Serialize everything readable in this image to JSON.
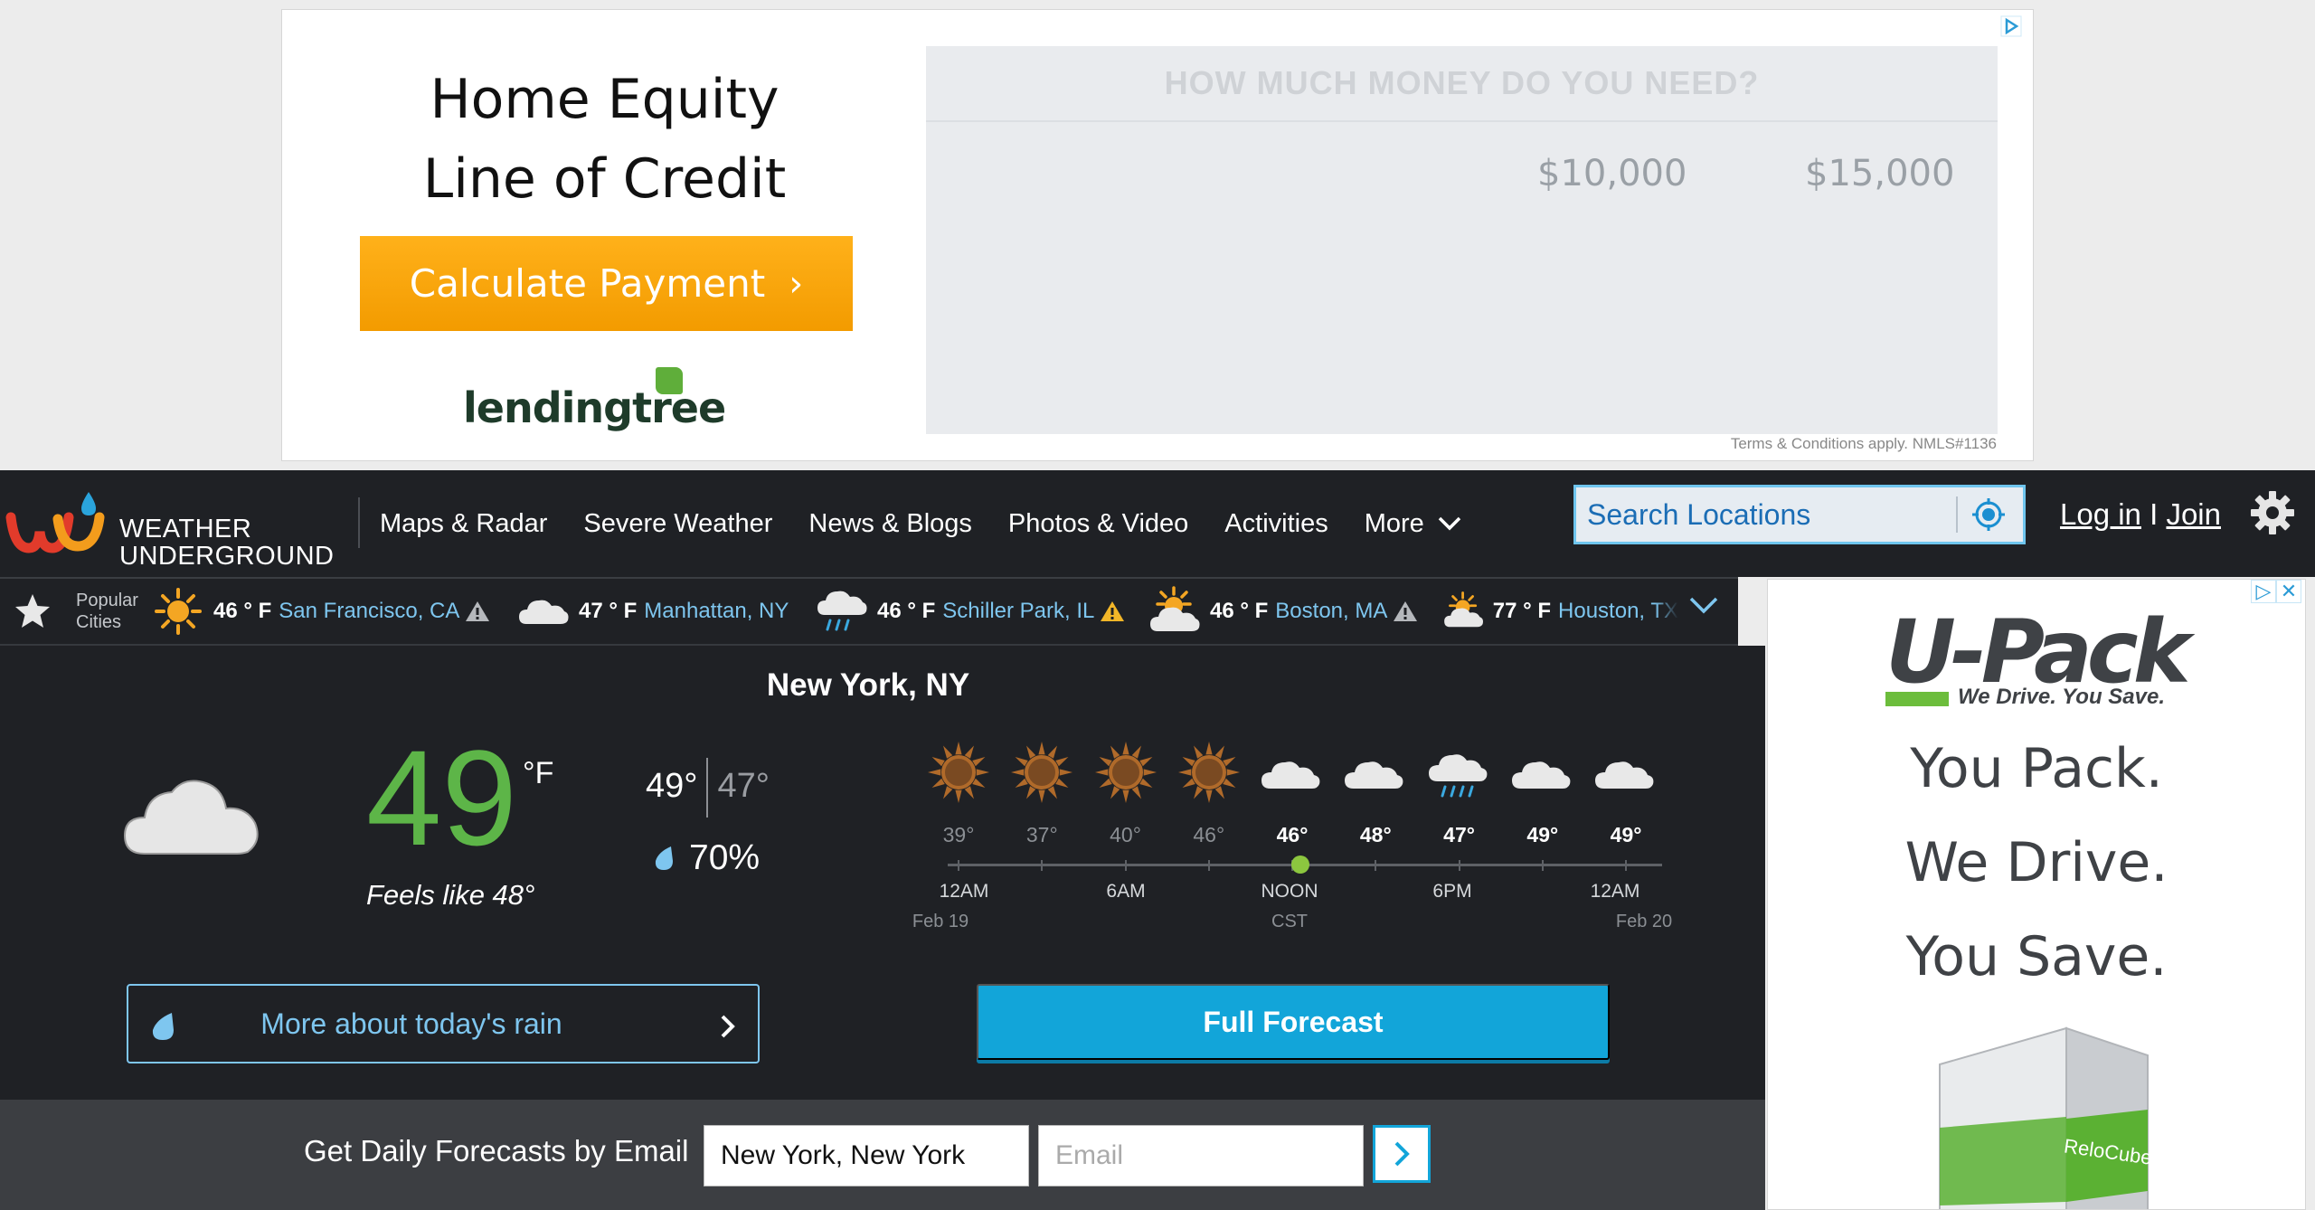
{
  "top_ad": {
    "title_line1": "Home Equity",
    "title_line2": "Line of Credit",
    "button_label": "Calculate Payment",
    "logo_text": "lendingtree",
    "question": "HOW MUCH MONEY DO YOU NEED?",
    "amounts": [
      "$10,000",
      "$15,000"
    ],
    "terms": "Terms & Conditions apply. NMLS#1136"
  },
  "nav": {
    "logo_line1": "WEATHER",
    "logo_line2": "UNDERGROUND",
    "items": [
      "Maps & Radar",
      "Severe Weather",
      "News & Blogs",
      "Photos & Video",
      "Activities",
      "More"
    ],
    "search_placeholder": "Search Locations",
    "login": "Log in",
    "login_sep": " I ",
    "join": "Join"
  },
  "popular": {
    "label_line1": "Popular",
    "label_line2": "Cities",
    "cities": [
      {
        "temp": "46 ° F",
        "name": "San Francisco, CA",
        "icon": "sun-icon",
        "alert": true
      },
      {
        "temp": "47 ° F",
        "name": "Manhattan, NY",
        "icon": "cloud-icon",
        "alert": false
      },
      {
        "temp": "46 ° F",
        "name": "Schiller Park, IL",
        "icon": "rain-cloud-icon",
        "alert": true
      },
      {
        "temp": "46 ° F",
        "name": "Boston, MA",
        "icon": "partly-cloudy-icon",
        "alert": true
      },
      {
        "temp": "77 ° F",
        "name": "Houston, TX",
        "icon": "partly-cloudy-icon",
        "alert": false
      }
    ]
  },
  "current": {
    "city": "New York, NY",
    "temp": "49",
    "unit": "°F",
    "feels_like": "Feels like 48°",
    "high": "49°",
    "low": "47°",
    "precip": "70%",
    "icon": "cloud-icon"
  },
  "hourly": {
    "temps": [
      "39°",
      "37°",
      "40°",
      "46°",
      "46°",
      "48°",
      "47°",
      "49°",
      "49°"
    ],
    "icons": [
      "sun-icon",
      "sun-icon",
      "sun-icon",
      "sun-icon",
      "cloud-icon",
      "cloud-icon",
      "rain-cloud-icon",
      "cloud-icon",
      "cloud-icon"
    ],
    "labels": [
      "12AM",
      "6AM",
      "NOON",
      "6PM",
      "12AM"
    ],
    "sublabels": [
      "Feb 19",
      "CST",
      "Feb 20"
    ]
  },
  "buttons": {
    "rain": "More about today's rain",
    "forecast": "Full Forecast"
  },
  "email": {
    "label": "Get Daily Forecasts by Email",
    "city_value": "New York, New York",
    "email_placeholder": "Email"
  },
  "side_ad": {
    "brand": "U-Pack",
    "tagline": "We Drive. You Save.",
    "lines": [
      "You Pack.",
      "We Drive.",
      "You Save."
    ],
    "cube_label": "ReloCube"
  },
  "colors": {
    "nav_bg": "#1f2125",
    "temp_green": "#5db548",
    "link_blue": "#7ec6ef",
    "button_blue": "#12a5d9",
    "ad_orange": "#f7a50f"
  }
}
